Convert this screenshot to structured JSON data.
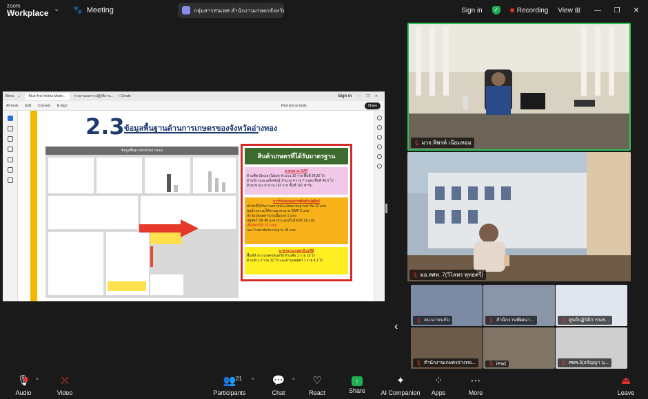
{
  "app": {
    "zoom_label": "zoom",
    "workplace_label": "Workplace",
    "meeting_label": "Meeting"
  },
  "meeting_title": "กลุ่มสารสนเทศ สำนักงานเกษตรจังหวัด",
  "top_right": {
    "signin": "Sign in",
    "recording": "Recording",
    "view": "View"
  },
  "browser": {
    "menu": "Menu",
    "tab1": "Blue And Yellow Mode...",
    "tab2": "รายงานผลการปฏิบัติงาน...",
    "new_tab": "+ Create",
    "signin": "Sign in"
  },
  "pdf_tools": {
    "all_tools": "All tools",
    "edit": "Edit",
    "convert": "Convert",
    "esign": "E-Sign",
    "find": "Find text or tools",
    "share": "Share"
  },
  "slide": {
    "number": "2.3",
    "title": "ข้อมูลพื้นฐานด้านการเกษตรของจังหวัดอ่างทอง",
    "infographic_title": "ข้อมูลพื้นฐานจังหวัดอ่างทอง",
    "std_title": "สินค้าเกษตรที่ได้รับมาตรฐาน",
    "gap_head": "มาตรฐาน GAP",
    "gap_lines": [
      "ด้านพืช (ผักและไม้ผล) จำนวน 10 ราย พื้นที่ 38.25 ไร่",
      "ด้านข้าวและเมล็ดพันธุ์ จำนวน 4 ราย 7 แปลง พื้นที่ 40.5 ไร่",
      "ด้านประมง จำนวน 162 ราย พื้นที่ 162 ฟาร์ม"
    ],
    "gmp_head": "การรับรองคุณภาพสินค้าปศุสัตว์",
    "gmp_lines": [
      "ฟาร์มที่ได้รับการตรวจประเมินมาตรฐานฟาร์ม 23 แห่ง",
      "ศูนย์รวบรวมให้ตามมาตรฐาน GMP 2 แห่ง",
      "ฟาร์มปลอดสารเร่งเนื้อแดง 1 แห่ง",
      "ปศุสัตว์ OK 48 แห่ง (จำแนกเป็นไข่OK 26 แห่ง",
      "เนื้อสัตว์OK 22 แห่ง)",
      "และโรงฆ่าสัตว์มาตรฐาน 38 แห่ง"
    ],
    "org_head": "มาตรฐานเกษตรอินทรีย์",
    "org_lines": [
      "พื้นที่ทำการเกษตรอินทรีย์ ด้านพืช 1 ราย 10 ไร่",
      "ด้านข้าว 2 ราย 31 ไร่ และด้านปศุสัตว์ 1 ราย 4.1 ไร่"
    ]
  },
  "participants_main": {
    "p1": "ผวจ.พิพรค์ เนียมหอม",
    "p2": "ผอ.สศท. 7(วิไลพร พุทธศรี)"
  },
  "gallery": [
    "จบ.นาบนกับ",
    "สำนักงานพัฒนา...",
    "ศูนย์ปฏิบัติการนพ...",
    "สำนักงานเกษตรอ่างทอ...",
    "iPad",
    "ศพพ.5(อรัญญา บุ..."
  ],
  "toolbar": {
    "audio": "Audio",
    "video": "Video",
    "participants": "Participants",
    "participants_count": "21",
    "chat": "Chat",
    "react": "React",
    "share": "Share",
    "ai": "AI Companion",
    "apps": "Apps",
    "more": "More",
    "leave": "Leave"
  },
  "colors": {
    "active_speaker": "#31c25a",
    "recording": "#e5302f",
    "share_green": "#20b04f",
    "slide_navy": "#1d3a6e",
    "slide_yellow": "#f5b700"
  }
}
